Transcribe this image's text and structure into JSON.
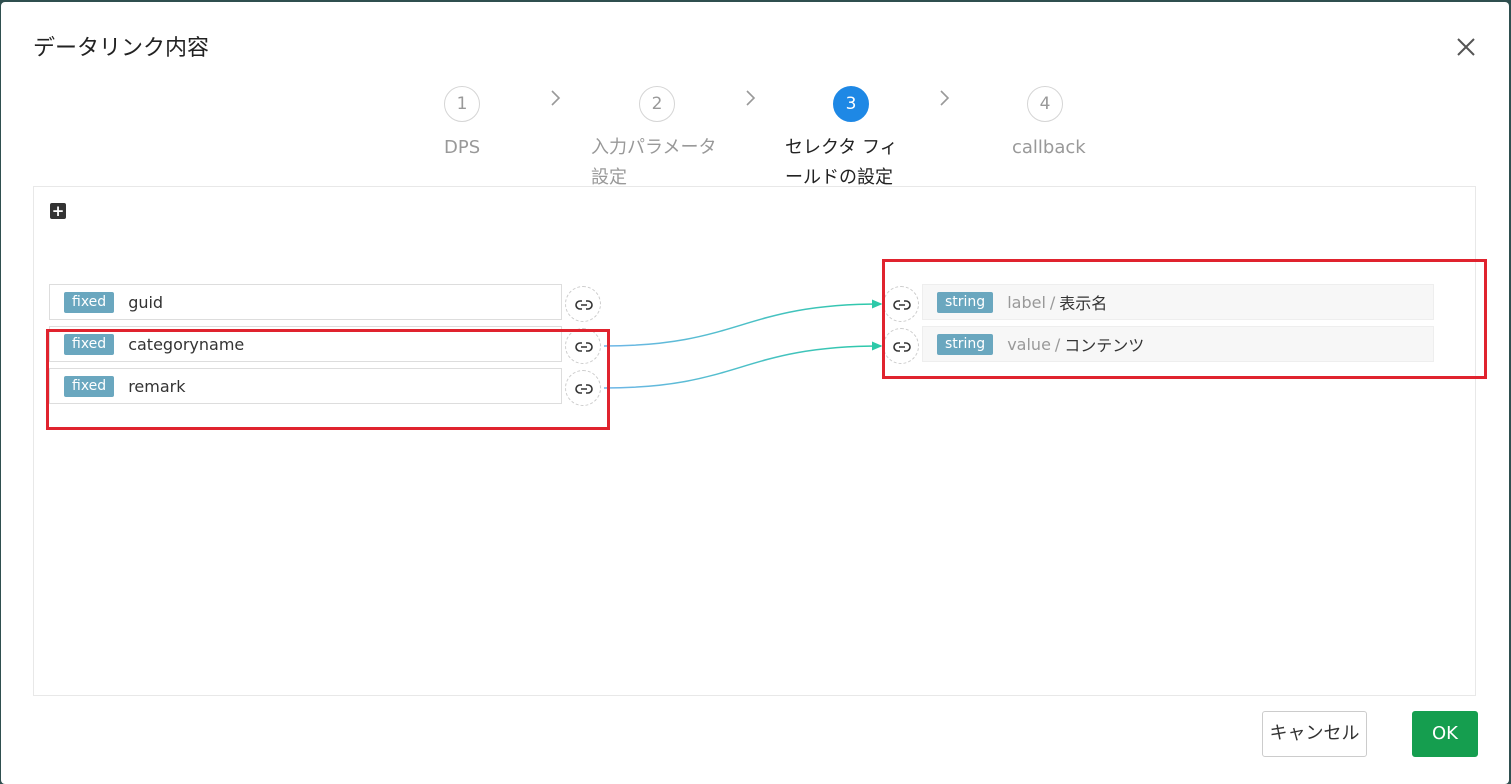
{
  "dialog": {
    "title": "データリンク内容"
  },
  "steps": [
    {
      "number": "1",
      "line1": "DPS",
      "line2": ""
    },
    {
      "number": "2",
      "line1": "入力パラメータ",
      "line2": "設定"
    },
    {
      "number": "3",
      "line1": "セレクタ フィ",
      "line2": "ールドの設定"
    },
    {
      "number": "4",
      "line1": "callback",
      "line2": ""
    }
  ],
  "active_step": 3,
  "source_fields": [
    {
      "badge": "fixed",
      "name": "guid"
    },
    {
      "badge": "fixed",
      "name": "categoryname"
    },
    {
      "badge": "fixed",
      "name": "remark"
    }
  ],
  "target_fields": [
    {
      "badge": "string",
      "key": "label",
      "separator": "/",
      "name": "表示名"
    },
    {
      "badge": "string",
      "key": "value",
      "separator": "/",
      "name": "コンテンツ"
    }
  ],
  "links": [
    {
      "from": "categoryname",
      "to": "label"
    },
    {
      "from": "remark",
      "to": "value"
    }
  ],
  "buttons": {
    "cancel": "キャンセル",
    "ok": "OK"
  },
  "colors": {
    "active_step": "#1e88e5",
    "ok_button": "#159e4f",
    "highlight": "#e0232e",
    "badge": "#6aa7bf"
  }
}
